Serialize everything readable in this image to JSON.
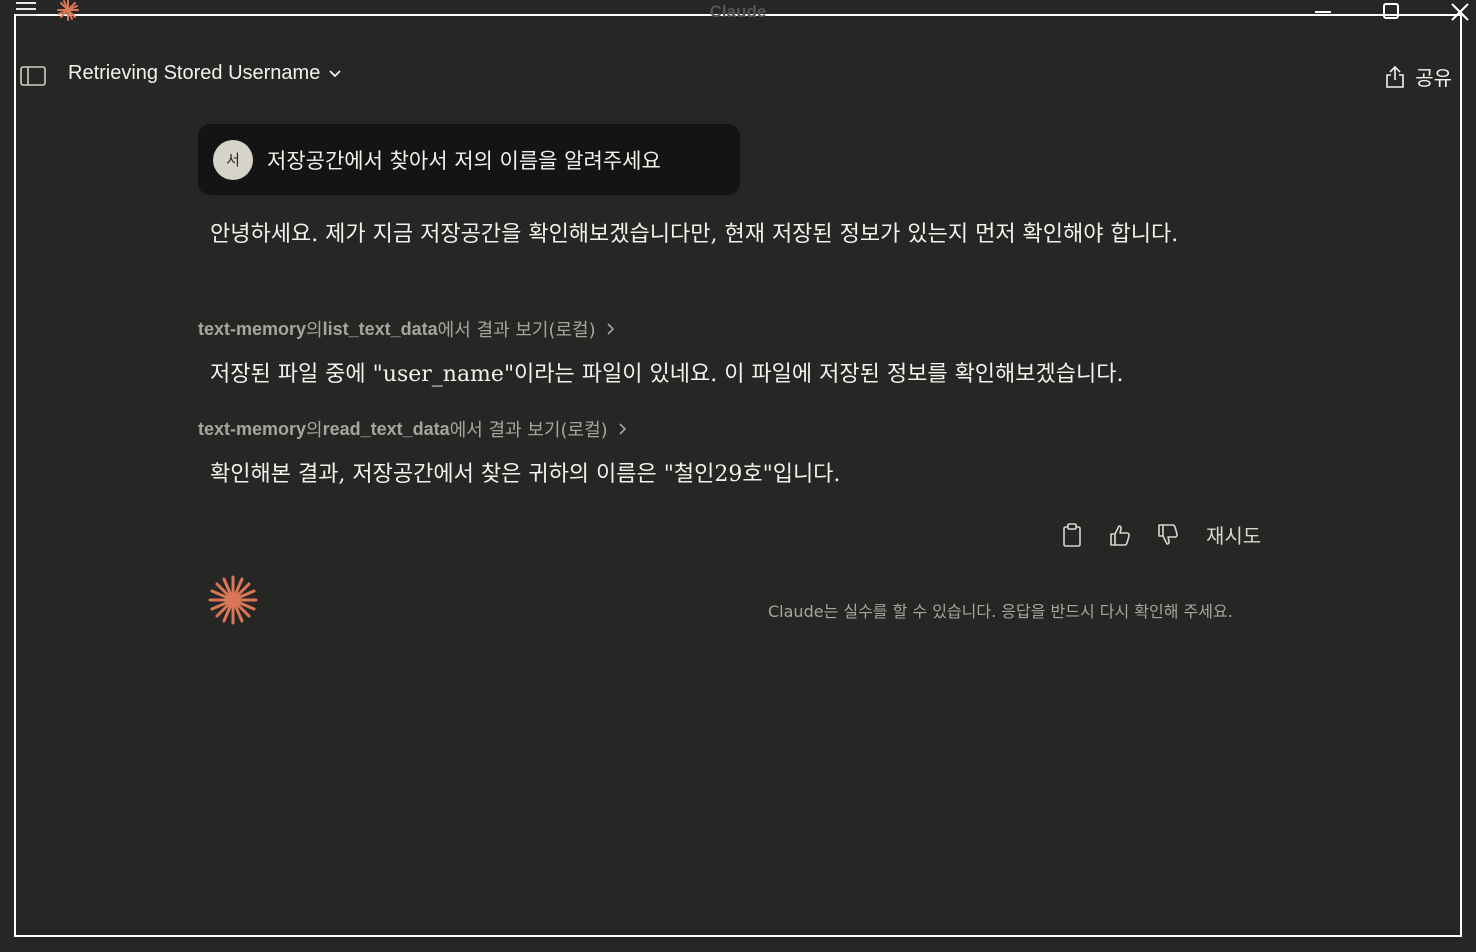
{
  "window": {
    "title": "Claude"
  },
  "header": {
    "chat_title": "Retrieving Stored Username",
    "share_label": "공유"
  },
  "conversation": {
    "user_message": {
      "avatar_initial": "서",
      "text": "저장공간에서 찾아서 저의 이름을 알려주세요"
    },
    "assistant": {
      "intro": "안녕하세요. 제가 지금 저장공간을 확인해보겠습니다만, 현재 저장된 정보가 있는지 먼저 확인해야 합니다.",
      "tool_call_1": {
        "server": "text-memory",
        "particle": "의",
        "tool": "list_text_data",
        "suffix": "에서 결과 보기(로컬)"
      },
      "after_tool_1": "저장된 파일 중에 \"user_name\"이라는 파일이 있네요. 이 파일에 저장된 정보를 확인해보겠습니다.",
      "tool_call_2": {
        "server": "text-memory",
        "particle": "의",
        "tool": "read_text_data",
        "suffix": "에서 결과 보기(로컬)"
      },
      "answer": "확인해본 결과, 저장공간에서 찾은 귀하의 이름은 \"철인29호\"입니다."
    },
    "actions": {
      "copy_icon": "clipboard-icon",
      "thumbs_up_icon": "thumbs-up-icon",
      "thumbs_down_icon": "thumbs-down-icon",
      "retry_label": "재시도"
    },
    "disclaimer": "Claude는 실수를 할 수 있습니다. 응답을 반드시 다시 확인해 주세요."
  },
  "colors": {
    "background": "#262624",
    "user_bubble": "#141413",
    "brand_orange": "#d97757",
    "muted_text": "#a6a49e"
  }
}
